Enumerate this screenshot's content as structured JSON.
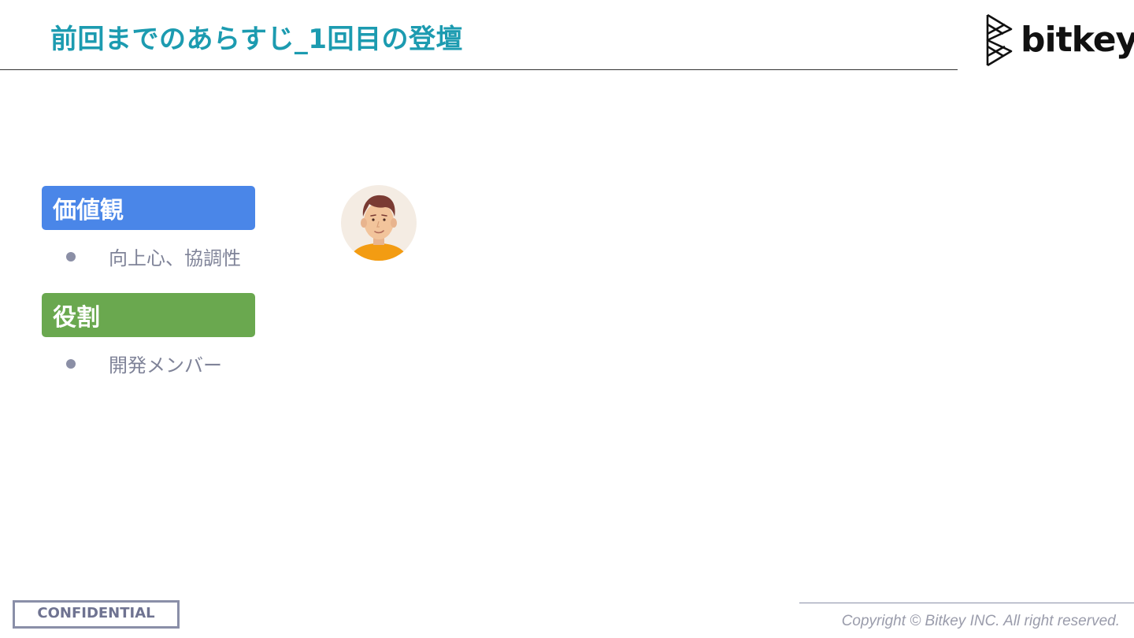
{
  "slide": {
    "title": "前回までのあらすじ_1回目の登壇"
  },
  "logo": {
    "text": "bitkey"
  },
  "profile": {
    "values_header": "価値観",
    "values_color": "#4a86e8",
    "values_item": "向上心、協調性",
    "role_header": "役割",
    "role_color": "#6aa84f",
    "role_item": "開発メンバー"
  },
  "avatar": {
    "icon": "person-avatar-icon"
  },
  "footer": {
    "confidential": "CONFIDENTIAL",
    "copyright": "Copyright © Bitkey INC. All right reserved."
  }
}
